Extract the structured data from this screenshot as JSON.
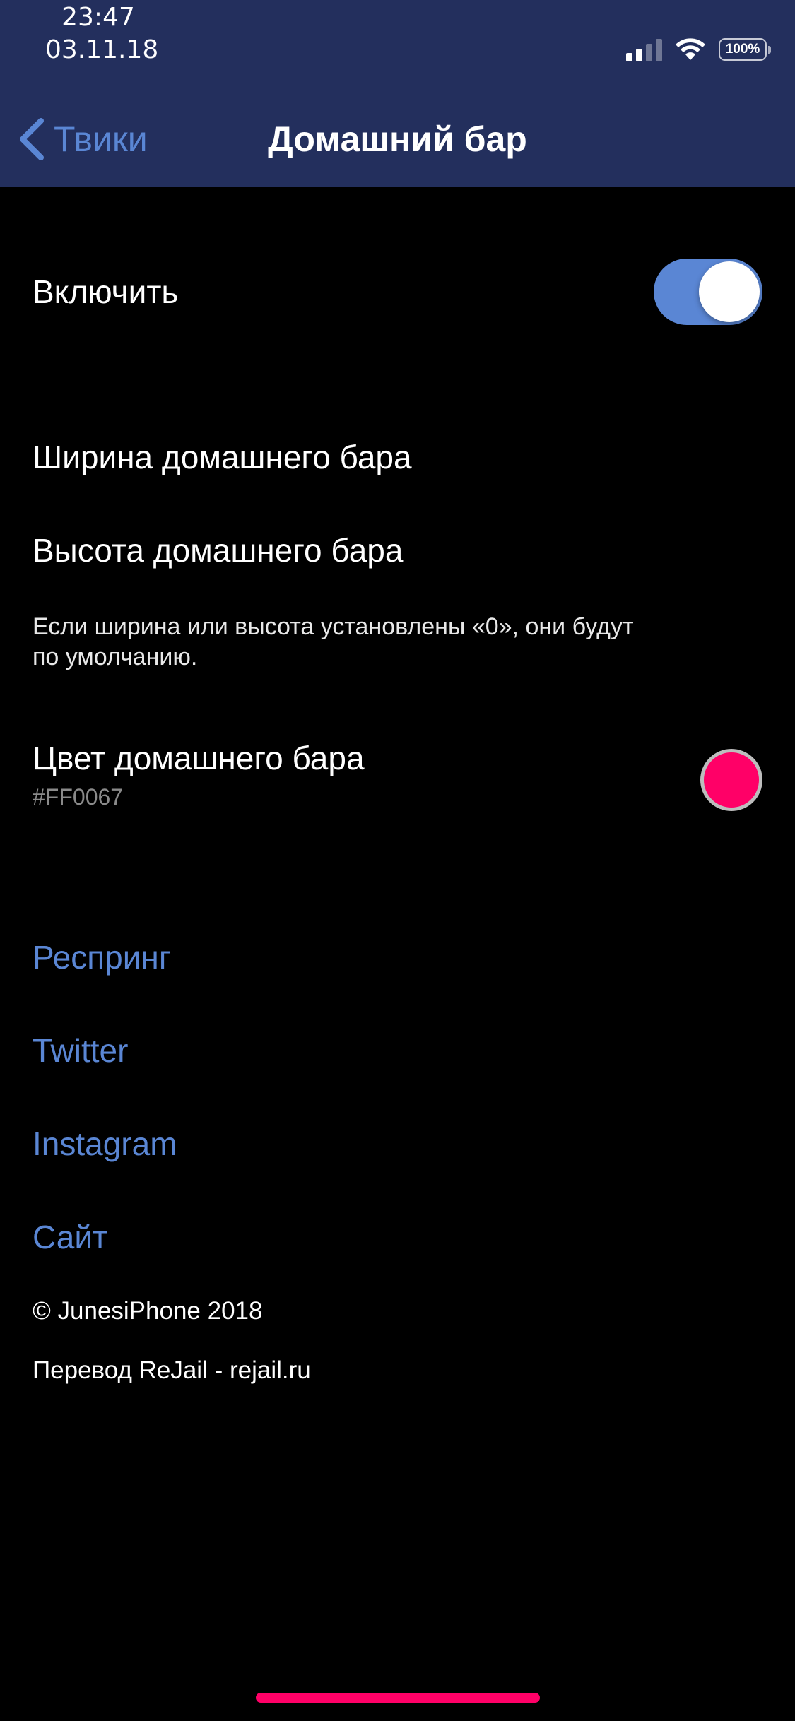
{
  "status_bar": {
    "time": "23:47",
    "date": "03.11.18",
    "battery_text": "100%",
    "icons": [
      "signal-icon",
      "wifi-icon",
      "battery-icon"
    ]
  },
  "nav": {
    "back_label": "Твики",
    "title": "Домашний бар"
  },
  "settings": {
    "enable_label": "Включить",
    "enable_state": true,
    "width_label": "Ширина домашнего бара",
    "height_label": "Высота домашнего бара",
    "footnote_line1": "Если ширина или высота установлены «0», они будут",
    "footnote_line2": "по умолчанию.",
    "color_label": "Цвет домашнего бара",
    "color_value": "#FF0067"
  },
  "links": {
    "respring": "Респринг",
    "twitter": "Twitter",
    "instagram": "Instagram",
    "site": "Сайт"
  },
  "footer": {
    "copyright": "© JunesiPhone 2018",
    "translation": "Перевод ReJail - rejail.ru"
  },
  "colors": {
    "header_bg": "#232f5d",
    "accent": "#5a86d4",
    "home_bar": "#FF0067"
  }
}
